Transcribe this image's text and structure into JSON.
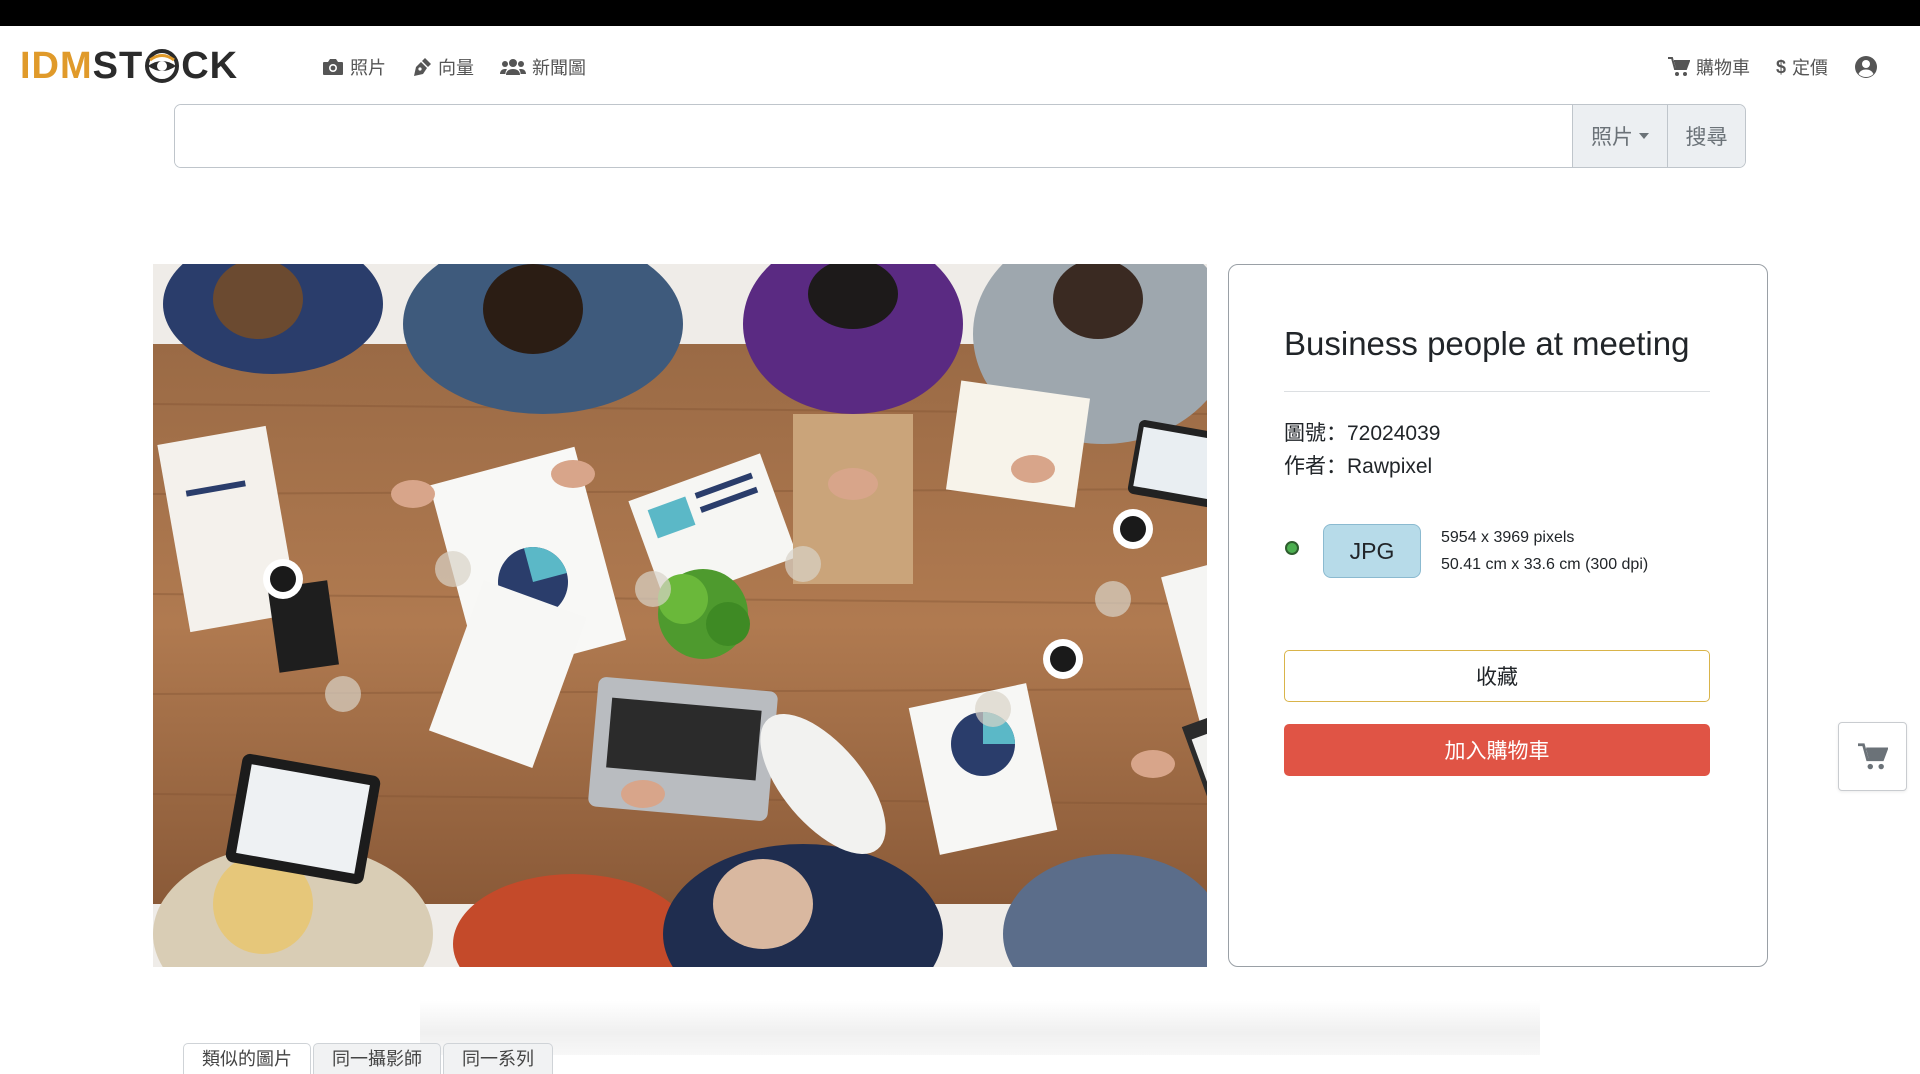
{
  "logo": {
    "part1": "IDM",
    "part2a": "ST",
    "part2b": "CK"
  },
  "nav": {
    "left": [
      {
        "label": "照片",
        "icon": "camera-icon"
      },
      {
        "label": "向量",
        "icon": "pen-nib-icon"
      },
      {
        "label": "新聞圖",
        "icon": "users-icon"
      }
    ],
    "cart_label": "購物車",
    "pricing_label": "定價"
  },
  "search": {
    "value": "",
    "placeholder": "",
    "category": "照片",
    "submit_label": "搜尋"
  },
  "photo": {
    "alt": "Business people at meeting"
  },
  "details": {
    "title": "Business people at meeting",
    "id_label": "圖號：",
    "id_value": "72024039",
    "author_label": "作者：",
    "author_value": "Rawpixel",
    "format": "JPG",
    "pixels": "5954 x 3969 pixels",
    "print_size": "50.41 cm x 33.6 cm (300 dpi)",
    "favorite_label": "收藏",
    "add_to_cart_label": "加入購物車"
  },
  "colors": {
    "brand_orange": "#e09a2a",
    "cart_button": "#e05445",
    "format_badge": "#b7dbe9",
    "available_dot": "#4caf50"
  },
  "tabs": [
    {
      "label": "類似的圖片"
    },
    {
      "label": "同一攝影師"
    },
    {
      "label": "同一系列"
    }
  ]
}
